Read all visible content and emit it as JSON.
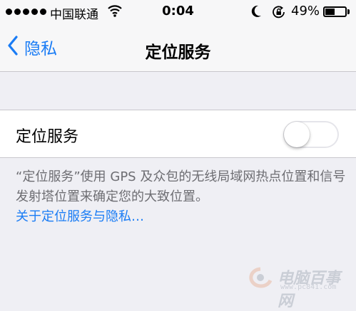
{
  "status_bar": {
    "carrier": "中国联通",
    "time": "0:04",
    "battery_percent": "49%",
    "battery_level": 0.49,
    "signal_bars": 5,
    "icons": [
      "signal-dots-icon",
      "wifi-icon",
      "moon-icon",
      "rotation-lock-icon",
      "battery-icon"
    ]
  },
  "nav": {
    "back_label": "隐私",
    "title": "定位服务",
    "back_icon": "chevron-left-icon"
  },
  "settings": {
    "location_services_label": "定位服务",
    "location_services_enabled": false
  },
  "footer": {
    "description": "“定位服务”使用 GPS 及众包的无线局域网热点位置和信号发射塔位置来确定您的大致位置。",
    "link_text": "关于定位服务与隐私…"
  },
  "watermark": {
    "text": "电脑百事网",
    "url": "www.pc841.com"
  },
  "colors": {
    "accent": "#1a7cf5",
    "background": "#efeff4",
    "bar": "#f7f7f8",
    "secondary_text": "#6d6d72",
    "separator": "#c8c7cc"
  }
}
